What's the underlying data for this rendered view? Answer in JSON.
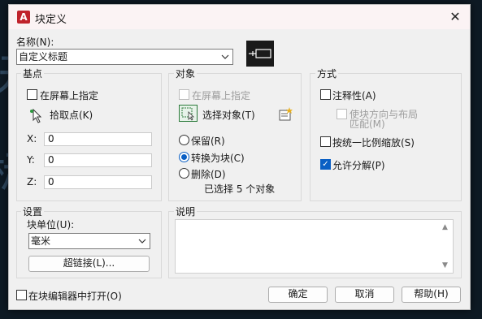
{
  "window": {
    "title": "块定义",
    "close_glyph": "✕"
  },
  "name": {
    "label": "名称(N):",
    "value": "自定义标题"
  },
  "base_point": {
    "group_label": "基点",
    "specify_on_screen": "在屏幕上指定",
    "pick_point": "拾取点(K)",
    "x_label": "X:",
    "x_value": "0",
    "y_label": "Y:",
    "y_value": "0",
    "z_label": "Z:",
    "z_value": "0"
  },
  "objects": {
    "group_label": "对象",
    "specify_on_screen": "在屏幕上指定",
    "select_objects": "选择对象(T)",
    "retain": "保留(R)",
    "convert_to_block": "转换为块(C)",
    "delete": "删除(D)",
    "selected_count": "已选择 5 个对象"
  },
  "behavior": {
    "group_label": "方式",
    "annotative": "注释性(A)",
    "match_orientation_line1": "使块方向与布局",
    "match_orientation_line2": "匹配(M)",
    "scale_uniformly": "按统一比例缩放(S)",
    "allow_exploding": "允许分解(P)"
  },
  "settings": {
    "group_label": "设置",
    "block_unit_label": "块单位(U):",
    "block_unit_value": "毫米",
    "hyperlink": "超链接(L)..."
  },
  "description": {
    "group_label": "说明",
    "value": ""
  },
  "footer": {
    "open_in_editor": "在块编辑器中打开(O)",
    "ok": "确定",
    "cancel": "取消",
    "help": "帮助(H)"
  },
  "background": {
    "glyph1": "块",
    "glyph2": "标"
  },
  "colors": {
    "accent": "#0a5fc4",
    "app_icon": "#c0232c",
    "titlebar": "#fbf3f4"
  }
}
